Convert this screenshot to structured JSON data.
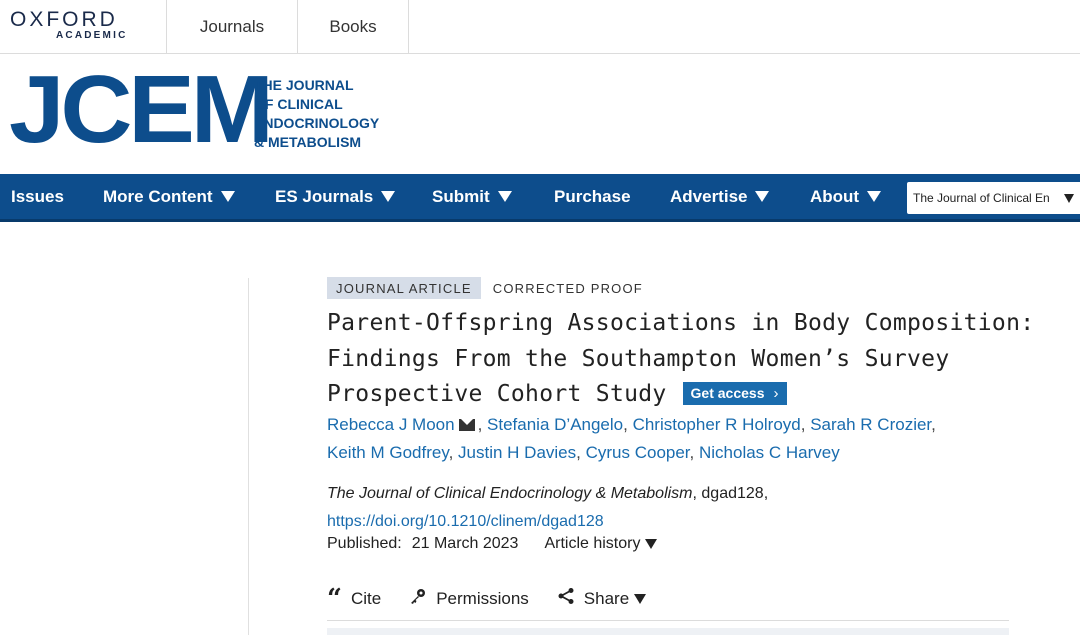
{
  "topbar": {
    "brand_top": "OXFORD",
    "brand_bottom": "ACADEMIC",
    "links": [
      "Journals",
      "Books"
    ]
  },
  "journal_brand": {
    "mark": "JCEM",
    "full_name_lines": [
      "THE JOURNAL",
      "OF CLINICAL",
      "ENDOCRINOLOGY",
      "& METABOLISM"
    ]
  },
  "nav": {
    "items": [
      {
        "label": "Issues",
        "has_dropdown": false
      },
      {
        "label": "More Content",
        "has_dropdown": true
      },
      {
        "label": "ES Journals",
        "has_dropdown": true
      },
      {
        "label": "Submit",
        "has_dropdown": true
      },
      {
        "label": "Purchase",
        "has_dropdown": false
      },
      {
        "label": "Advertise",
        "has_dropdown": true
      },
      {
        "label": "About",
        "has_dropdown": true
      }
    ],
    "journal_select_value": "The Journal of Clinical En"
  },
  "article": {
    "type_tag": "JOURNAL ARTICLE",
    "status_tag": "CORRECTED PROOF",
    "title_lines": [
      "Parent-Offspring Associations in Body Composition:",
      "Findings From the Southampton Women’s Survey",
      "Prospective Cohort Study"
    ],
    "get_access_label": "Get access",
    "authors": [
      "Rebecca J Moon",
      "Stefania D’Angelo",
      "Christopher R Holroyd",
      "Sarah R Crozier",
      "Keith M Godfrey",
      "Justin H Davies",
      "Cyrus Cooper",
      "Nicholas C Harvey"
    ],
    "journal_name": "The Journal of Clinical Endocrinology & Metabolism",
    "article_id": ", dgad128,",
    "doi": "https://doi.org/10.1210/clinem/dgad128",
    "published_label": "Published:",
    "published_date": "21 March 2023",
    "history_label": "Article history"
  },
  "tools": {
    "cite": "Cite",
    "permissions": "Permissions",
    "share": "Share"
  },
  "colors": {
    "brand_blue": "#0d4d8c",
    "link_blue": "#1a6cae",
    "tag_bg": "#d6dde8"
  }
}
